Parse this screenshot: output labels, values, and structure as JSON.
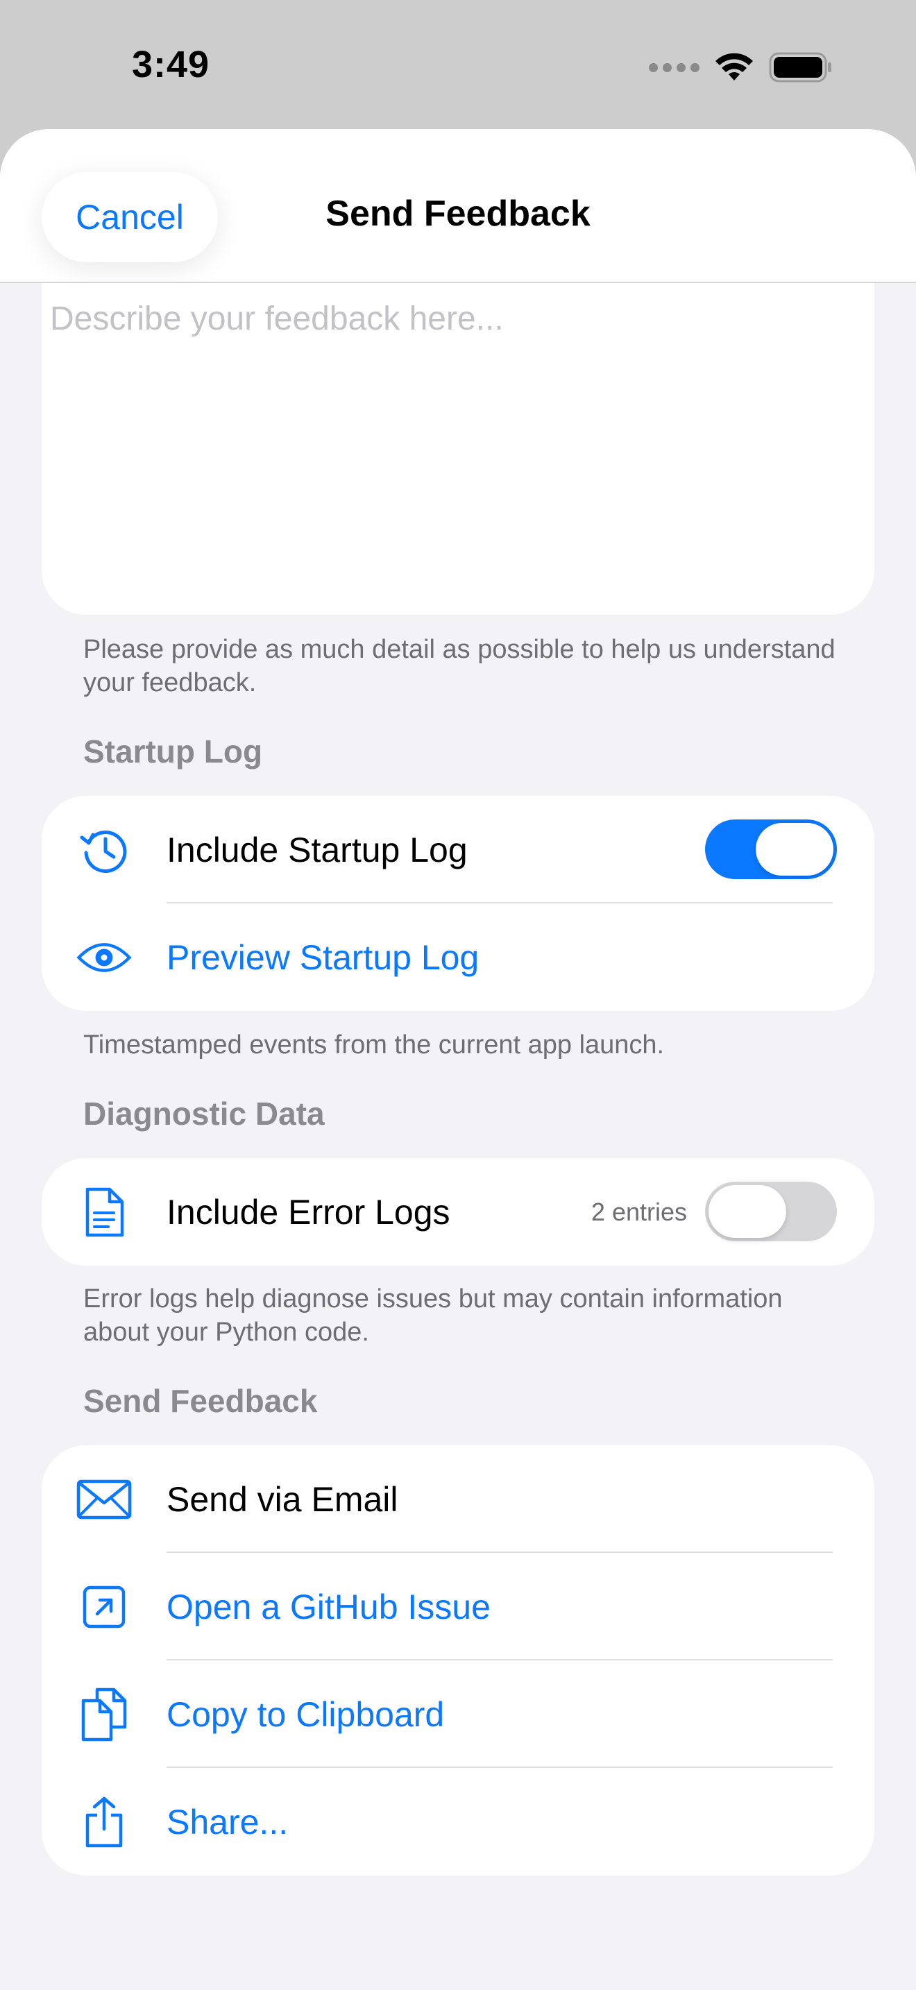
{
  "status_bar": {
    "time": "3:49"
  },
  "nav": {
    "cancel_label": "Cancel",
    "title": "Send Feedback"
  },
  "feedback": {
    "placeholder": "Describe your feedback here...",
    "footer": "Please provide as much detail as possible to help us understand your feedback."
  },
  "startup_log": {
    "header": "Startup Log",
    "include_label": "Include Startup Log",
    "include_enabled": true,
    "preview_label": "Preview Startup Log",
    "footer": "Timestamped events from the current app launch."
  },
  "diagnostic": {
    "header": "Diagnostic Data",
    "include_errors_label": "Include Error Logs",
    "entries": "2 entries",
    "include_errors_enabled": false,
    "footer": "Error logs help diagnose issues but may contain information about your Python code."
  },
  "send": {
    "header": "Send Feedback",
    "email_label": "Send via Email",
    "github_label": "Open a GitHub Issue",
    "clipboard_label": "Copy to Clipboard",
    "share_label": "Share..."
  },
  "icons": {
    "startup": "clock-arrow-icon",
    "preview": "eye-icon",
    "error_logs": "document-icon",
    "email": "envelope-icon",
    "github": "arrow-up-right-square-icon",
    "clipboard": "copy-documents-icon",
    "share": "share-icon"
  },
  "colors": {
    "accent": "#0a78ff",
    "background": "#f2f2f7",
    "card": "#ffffff"
  }
}
